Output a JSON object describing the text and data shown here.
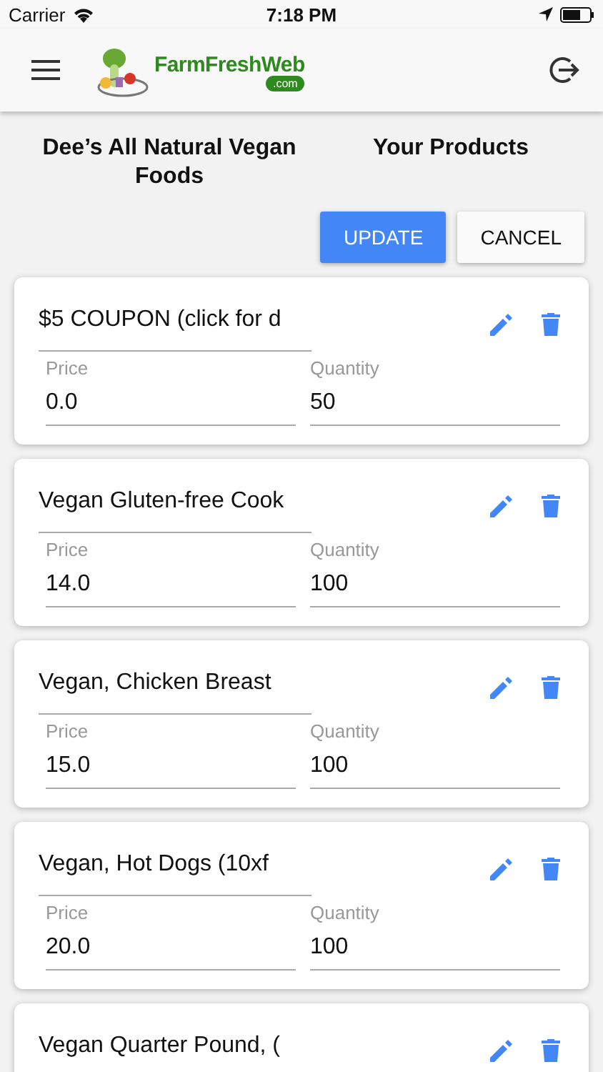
{
  "status_bar": {
    "carrier": "Carrier",
    "time": "7:18 PM"
  },
  "header": {
    "logo_text": "FarmFreshWeb",
    "logo_sub": ".com"
  },
  "store_name": "Dee’s All Natural Vegan Foods",
  "page_title": "Your Products",
  "buttons": [
    {
      "label": "UPDATE",
      "kind": "primary"
    },
    {
      "label": "CANCEL",
      "kind": "secondary"
    }
  ],
  "products": [
    {
      "name": "$5 COUPON (click for d",
      "price_label": "Price",
      "price": "0.0",
      "quantity_label": "Quantity",
      "quantity": "50"
    },
    {
      "name": "Vegan Gluten-free Cook",
      "price_label": "Price",
      "price": "14.0",
      "quantity_label": "Quantity",
      "quantity": "100"
    },
    {
      "name": "Vegan, Chicken Breast",
      "price_label": "Price",
      "price": "15.0",
      "quantity_label": "Quantity",
      "quantity": "100"
    },
    {
      "name": "Vegan, Hot Dogs (10xf",
      "price_label": "Price",
      "price": "20.0",
      "quantity_label": "Quantity",
      "quantity": "100"
    },
    {
      "name": "Vegan Quarter Pound, ("
    }
  ]
}
